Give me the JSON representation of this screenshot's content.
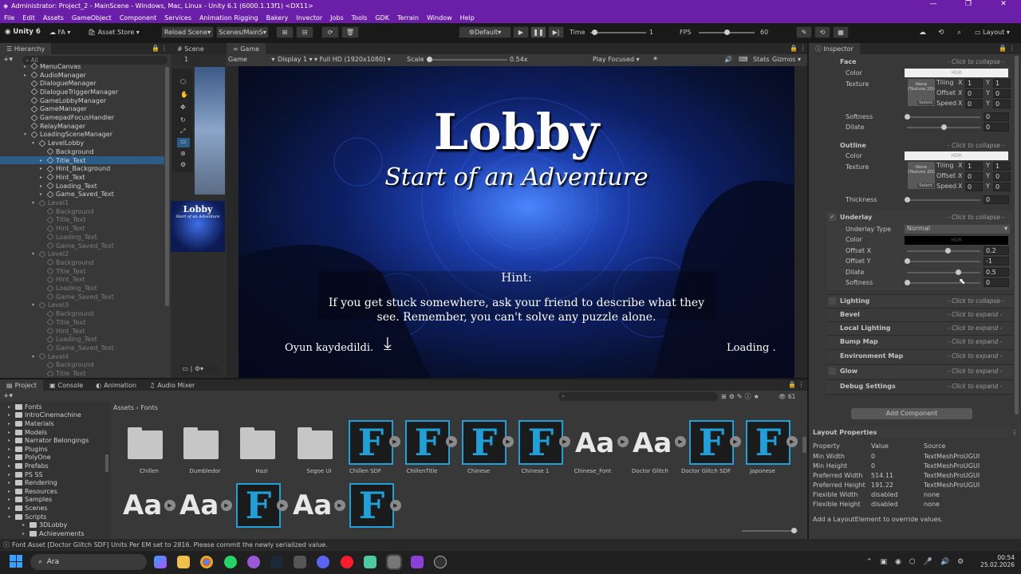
{
  "window": {
    "title": "Administrator: Project_2 - MainScene - Windows, Mac, Linux - Unity 6.1 (6000.1.13f1) <DX11>"
  },
  "menu": [
    "File",
    "Edit",
    "Assets",
    "GameObject",
    "Component",
    "Services",
    "Animation Rigging",
    "Bakery",
    "Invector",
    "Jobs",
    "Tools",
    "GDK",
    "Terrain",
    "Window",
    "Help"
  ],
  "toolbar": {
    "unity": "Unity 6",
    "account": "FA",
    "asset_store": "Asset Store",
    "reload": "Reload Scene",
    "scenes": "Scenes/MainS",
    "default": "Default",
    "time_label": "Time",
    "time_value": "1",
    "fps_label": "FPS",
    "fps_value": "60",
    "layout": "Layout"
  },
  "hierarchy": {
    "title": "Hierarchy",
    "search": "All",
    "rows": [
      {
        "t": "MenuCanvas",
        "i": 0,
        "a": "▸",
        "d": false,
        "s": false
      },
      {
        "t": "AudioManager",
        "i": 0,
        "a": "▸",
        "d": false,
        "s": false
      },
      {
        "t": "DialogueManager",
        "i": 0,
        "a": "",
        "d": false,
        "s": false
      },
      {
        "t": "DialogueTriggerManager",
        "i": 0,
        "a": "",
        "d": false,
        "s": false
      },
      {
        "t": "GameLobbyManager",
        "i": 0,
        "a": "",
        "d": false,
        "s": false
      },
      {
        "t": "GameManager",
        "i": 0,
        "a": "",
        "d": false,
        "s": false
      },
      {
        "t": "GamepadFocusHandler",
        "i": 0,
        "a": "",
        "d": false,
        "s": false
      },
      {
        "t": "RelayManager",
        "i": 0,
        "a": "",
        "d": false,
        "s": false
      },
      {
        "t": "LoadingSceneManager",
        "i": 0,
        "a": "▾",
        "d": false,
        "s": false
      },
      {
        "t": "LevelLobby",
        "i": 1,
        "a": "▾",
        "d": false,
        "s": false
      },
      {
        "t": "Background",
        "i": 2,
        "a": "",
        "d": false,
        "s": false
      },
      {
        "t": "Title_Text",
        "i": 2,
        "a": "▸",
        "d": false,
        "s": true
      },
      {
        "t": "Hint_Background",
        "i": 2,
        "a": "▸",
        "d": false,
        "s": false
      },
      {
        "t": "Hint_Text",
        "i": 2,
        "a": "▸",
        "d": false,
        "s": false
      },
      {
        "t": "Loading_Text",
        "i": 2,
        "a": "▸",
        "d": false,
        "s": false
      },
      {
        "t": "Game_Saved_Text",
        "i": 2,
        "a": "▸",
        "d": false,
        "s": false
      },
      {
        "t": "Level1",
        "i": 1,
        "a": "▾",
        "d": true,
        "s": false
      },
      {
        "t": "Background",
        "i": 2,
        "a": "",
        "d": true,
        "s": false
      },
      {
        "t": "Title_Text",
        "i": 2,
        "a": "",
        "d": true,
        "s": false
      },
      {
        "t": "Hint_Text",
        "i": 2,
        "a": "",
        "d": true,
        "s": false
      },
      {
        "t": "Loading_Text",
        "i": 2,
        "a": "",
        "d": true,
        "s": false
      },
      {
        "t": "Game_Saved_Text",
        "i": 2,
        "a": "",
        "d": true,
        "s": false
      },
      {
        "t": "Level2",
        "i": 1,
        "a": "▾",
        "d": true,
        "s": false
      },
      {
        "t": "Background",
        "i": 2,
        "a": "",
        "d": true,
        "s": false
      },
      {
        "t": "Title_Text",
        "i": 2,
        "a": "",
        "d": true,
        "s": false
      },
      {
        "t": "Hint_Text",
        "i": 2,
        "a": "",
        "d": true,
        "s": false
      },
      {
        "t": "Loading_Text",
        "i": 2,
        "a": "",
        "d": true,
        "s": false
      },
      {
        "t": "Game_Saved_Text",
        "i": 2,
        "a": "",
        "d": true,
        "s": false
      },
      {
        "t": "Level3",
        "i": 1,
        "a": "▾",
        "d": true,
        "s": false
      },
      {
        "t": "Background",
        "i": 2,
        "a": "",
        "d": true,
        "s": false
      },
      {
        "t": "Title_Text",
        "i": 2,
        "a": "",
        "d": true,
        "s": false
      },
      {
        "t": "Hint_Text",
        "i": 2,
        "a": "",
        "d": true,
        "s": false
      },
      {
        "t": "Loading_Text",
        "i": 2,
        "a": "",
        "d": true,
        "s": false
      },
      {
        "t": "Game_Saved_Text",
        "i": 2,
        "a": "",
        "d": true,
        "s": false
      },
      {
        "t": "Level4",
        "i": 1,
        "a": "▾",
        "d": true,
        "s": false
      },
      {
        "t": "Background",
        "i": 2,
        "a": "",
        "d": true,
        "s": false
      },
      {
        "t": "Title_Text",
        "i": 2,
        "a": "",
        "d": true,
        "s": false
      }
    ]
  },
  "scene_tab": "Scene",
  "game_tab": "Game",
  "game_bar": {
    "mode": "Game",
    "display": "Display 1",
    "res": "Full HD (1920x1080)",
    "scale_label": "Scale",
    "scale_value": "0.54x",
    "play_focused": "Play Focused",
    "stats": "Stats",
    "gizmos": "Gizmos"
  },
  "scene_thumb_title": "Lobby",
  "scene_thumb_sub": "Start of an Adventure",
  "game": {
    "title": "Lobby",
    "subtitle": "Start of an Adventure",
    "hint_label": "Hint:",
    "hint_line1": "If you get stuck somewhere, ask your friend to describe what they",
    "hint_line2": "see. Remember, you can't solve any puzzle alone.",
    "saved": "Oyun kaydedildi.",
    "loading": "Loading ."
  },
  "inspector": {
    "title": "Inspector",
    "face": {
      "label": "Face",
      "collapse": "- Click to collapse -",
      "color": "Color",
      "texture": "Texture",
      "hdr": "HDR",
      "none_tex": "None (Texture 2D)",
      "select": "Select",
      "tiling": "Tiling",
      "offset": "Offset",
      "speed": "Speed",
      "tx": "1",
      "ty": "1",
      "ox": "0",
      "oy": "0",
      "sx": "0",
      "sy": "0",
      "softness": "Softness",
      "softness_v": "0",
      "softness_f": 0.0,
      "dilate": "Dilate",
      "dilate_v": "0",
      "dilate_f": 0.5
    },
    "outline": {
      "label": "Outline",
      "collapse": "- Click to collapse -",
      "color": "Color",
      "texture": "Texture",
      "hdr": "HDR",
      "none_tex": "None (Texture 2D)",
      "select": "Select",
      "tiling": "Tiling",
      "offset": "Offset",
      "speed": "Speed",
      "tx": "1",
      "ty": "1",
      "ox": "0",
      "oy": "0",
      "sx": "0",
      "sy": "0",
      "thickness": "Thickness",
      "thickness_v": "0",
      "thickness_f": 0.0
    },
    "underlay": {
      "label": "Underlay",
      "collapse": "- Click to collapse -",
      "type_label": "Underlay Type",
      "type_value": "Normal",
      "color": "Color",
      "hdr": "HDR",
      "ox_label": "Offset X",
      "ox": "0.2",
      "ox_f": 0.55,
      "oy_label": "Offset Y",
      "oy": "-1",
      "oy_f": 0.0,
      "dilate_label": "Dilate",
      "dilate": "0.5",
      "dilate_f": 0.7,
      "soft_label": "Softness",
      "soft": "0",
      "soft_f": 0.0
    },
    "sections": [
      {
        "label": "Lighting",
        "hint": "- Click to collapse -",
        "cb": true
      },
      {
        "label": "Bevel",
        "hint": "- Click to expand -",
        "cb": false
      },
      {
        "label": "Local Lighting",
        "hint": "- Click to expand -",
        "cb": false
      },
      {
        "label": "Bump Map",
        "hint": "- Click to expand -",
        "cb": false
      },
      {
        "label": "Environment Map",
        "hint": "- Click to expand -",
        "cb": false
      },
      {
        "label": "Glow",
        "hint": "- Click to expand -",
        "cb": true
      },
      {
        "label": "Debug Settings",
        "hint": "- Click to expand -",
        "cb": false
      }
    ],
    "add_component": "Add Component"
  },
  "layout_props": {
    "title": "Layout Properties",
    "headers": [
      "Property",
      "Value",
      "Source"
    ],
    "rows": [
      [
        "Min Width",
        "0",
        "TextMeshProUGUI"
      ],
      [
        "Min Height",
        "0",
        "TextMeshProUGUI"
      ],
      [
        "Preferred Width",
        "514.11",
        "TextMeshProUGUI"
      ],
      [
        "Preferred Height",
        "191.22",
        "TextMeshProUGUI"
      ],
      [
        "Flexible Width",
        "disabled",
        "none"
      ],
      [
        "Flexible Height",
        "disabled",
        "none"
      ]
    ],
    "footer": "Add a LayoutElement to override values."
  },
  "bottom_tabs": [
    "Project",
    "Console",
    "Animation",
    "Audio Mixer"
  ],
  "project": {
    "breadcrumb_root": "Assets",
    "breadcrumb_leaf": "Fonts",
    "count": "61",
    "folders": [
      "Fonts",
      "IntroCinemachine",
      "Materials",
      "Models",
      "Narrator Belongings",
      "Plugins",
      "PolyOne",
      "Prefabs",
      "PS SS",
      "Rendering",
      "Resources",
      "Samples",
      "Scenes",
      "Scripts",
      "3DLobby",
      "Achievements"
    ],
    "assets_row1": [
      {
        "n": "Chillen",
        "k": "folder"
      },
      {
        "n": "Dumbledor",
        "k": "folder"
      },
      {
        "n": "Hazi",
        "k": "folder"
      },
      {
        "n": "Segoe UI",
        "k": "folder"
      },
      {
        "n": "Chillen SDF",
        "k": "F"
      },
      {
        "n": "ChillenTitle",
        "k": "F"
      },
      {
        "n": "Chinese",
        "k": "F"
      },
      {
        "n": "Chinese 1",
        "k": "F"
      },
      {
        "n": "Chinese_Font",
        "k": "Aa"
      },
      {
        "n": "Doctor Glitch",
        "k": "Aa"
      },
      {
        "n": "Doctor Glitch SDF",
        "k": "F"
      },
      {
        "n": "Japonese",
        "k": "F"
      }
    ],
    "assets_row2": [
      "Aa",
      "Aa",
      "F",
      "Aa",
      "F"
    ]
  },
  "status": "Font Asset [Doctor Glitch SDF] Units Per EM set to 2816. Please commit the newly serialized value.",
  "taskbar": {
    "search": "Ara",
    "time": "00:54",
    "date": "25.02.2026"
  },
  "colors": {
    "accent": "#6b1fa8",
    "selection": "#2c5d87",
    "font_asset": "#1fa0d8"
  }
}
